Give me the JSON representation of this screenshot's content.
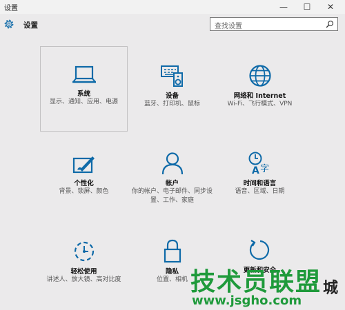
{
  "window": {
    "title": "设置",
    "min": "—",
    "max": "☐",
    "close": "✕"
  },
  "header": {
    "title": "设置",
    "search_placeholder": "查找设置"
  },
  "tiles": [
    {
      "name": "系统",
      "desc": "显示、通知、应用、电源",
      "icon": "laptop-icon"
    },
    {
      "name": "设备",
      "desc": "蓝牙、打印机、鼠标",
      "icon": "devices-icon"
    },
    {
      "name": "网络和 Internet",
      "desc": "Wi-Fi、飞行模式、VPN",
      "icon": "globe-icon"
    },
    {
      "name": "个性化",
      "desc": "背景、锁屏、颜色",
      "icon": "personalize-icon"
    },
    {
      "name": "帐户",
      "desc": "你的帐户、电子邮件、同步设置、工作、家庭",
      "icon": "person-icon"
    },
    {
      "name": "时间和语言",
      "desc": "语音、区域、日期",
      "icon": "time-language-icon"
    },
    {
      "name": "轻松使用",
      "desc": "讲述人、放大镜、高对比度",
      "icon": "ease-of-access-icon"
    },
    {
      "name": "隐私",
      "desc": "位置、相机",
      "icon": "lock-icon"
    },
    {
      "name": "更新和安全",
      "desc": "",
      "icon": "update-icon"
    }
  ],
  "watermark": {
    "main": "技术员联盟",
    "sub": "www.jsgho.com",
    "extra": "城"
  },
  "colors": {
    "accent": "#0e6aa8",
    "background": "#ebeaeb",
    "watermark": "#1f9a3b"
  }
}
